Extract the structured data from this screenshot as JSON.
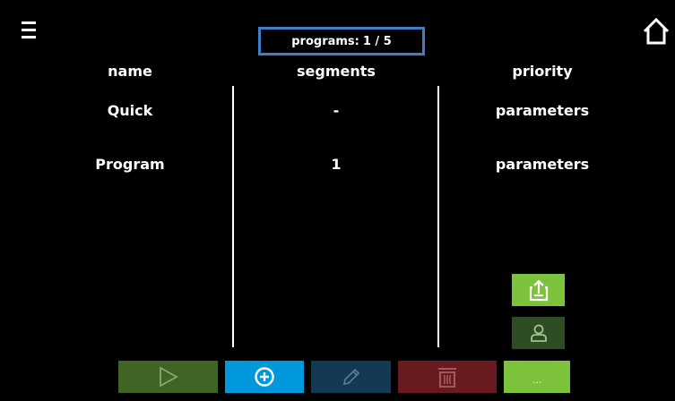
{
  "header": {
    "programs_label": "programs:",
    "programs_value": "1 / 5"
  },
  "columns": {
    "name": "name",
    "segments": "segments",
    "priority": "priority"
  },
  "programs": [
    {
      "name": "Quick",
      "segments": "-",
      "priority": "parameters"
    },
    {
      "name": "Program",
      "segments": "1",
      "priority": "parameters"
    }
  ],
  "toolbar": {
    "more_label": "..."
  },
  "icons": {
    "menu": "hamburger-menu-icon",
    "home": "home-icon",
    "export": "export-icon",
    "user": "user-icon",
    "play": "play-icon",
    "add": "plus-circle-icon",
    "edit": "pencil-icon",
    "delete": "trash-icon"
  },
  "colors": {
    "background": "#000000",
    "programs_border": "#3d7ec4",
    "green_active": "#7cc23a",
    "green_dark": "#3f6426",
    "green_user": "#2f4d24",
    "blue_add": "#0098dc",
    "blue_edit": "#123a55",
    "red_delete": "#681a1e"
  }
}
